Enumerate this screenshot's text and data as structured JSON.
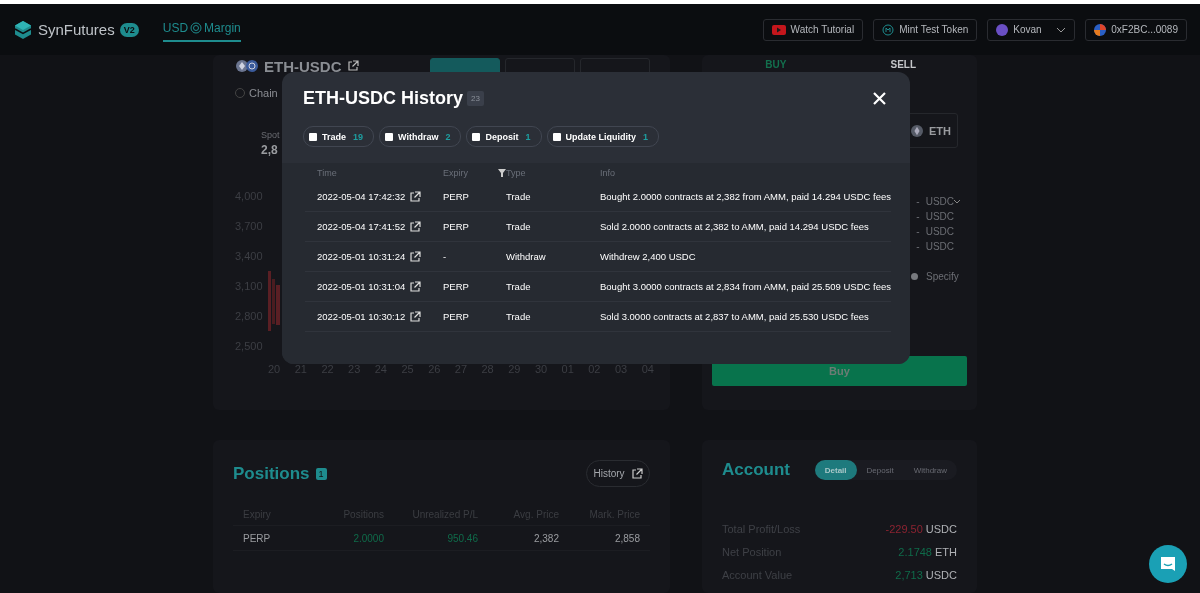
{
  "header": {
    "brand": "SynFutures",
    "version": "V2",
    "nav": [
      {
        "prefix": "USD",
        "suffix": "Margin",
        "selected": true
      }
    ],
    "actions": [
      {
        "kind": "tutorial",
        "label": "Watch Tutorial"
      },
      {
        "kind": "mint",
        "label": "Mint Test Token"
      },
      {
        "kind": "network",
        "label": "Kovan"
      },
      {
        "kind": "wallet",
        "label": "0xF2BC...0089"
      }
    ]
  },
  "trade_panel": {
    "pair": "ETH-USDC",
    "mode_tabs": [
      {
        "selected": true
      },
      {
        "selected": false
      },
      {
        "selected": false
      }
    ],
    "option": {
      "label": "Chain",
      "checked": false
    },
    "spot": {
      "label": "Spot",
      "value": "2,8"
    },
    "chart": {
      "y_labels": [
        "4,000",
        "3,700",
        "3,400",
        "3,100",
        "2,800",
        "2,500"
      ],
      "x_labels": [
        "20",
        "21",
        "22",
        "23",
        "24",
        "25",
        "26",
        "27",
        "28",
        "29",
        "30",
        "01",
        "02",
        "03",
        "04"
      ]
    }
  },
  "order_panel": {
    "sides": [
      {
        "label": "BUY",
        "selected": true
      },
      {
        "label": "SELL",
        "selected": false
      }
    ],
    "asset": "ETH",
    "amounts": [
      {
        "value": "-",
        "unit": "USDC",
        "dropdown": true
      },
      {
        "value": "-",
        "unit": "USDC",
        "dropdown": false
      },
      {
        "value": "-",
        "unit": "USDC",
        "dropdown": false
      },
      {
        "value": "-",
        "unit": "USDC",
        "dropdown": false
      }
    ],
    "option": {
      "label": "Specify",
      "checked": false
    },
    "submit": "Buy"
  },
  "history_modal": {
    "title": "ETH-USDC History",
    "count": "23",
    "filters": [
      {
        "label": "Trade",
        "count": "19",
        "checked": false
      },
      {
        "label": "Withdraw",
        "count": "2",
        "checked": false
      },
      {
        "label": "Deposit",
        "count": "1",
        "checked": false
      },
      {
        "label": "Update Liquidity",
        "count": "1",
        "checked": false
      }
    ],
    "columns": [
      "Time",
      "Expiry",
      "Type",
      "Info"
    ],
    "rows": [
      {
        "time": "2022-05-04 17:42:32",
        "expiry": "PERP",
        "type": "Trade",
        "info": "Bought 2.0000 contracts at 2,382 from AMM, paid 14.294 USDC fees"
      },
      {
        "time": "2022-05-04 17:41:52",
        "expiry": "PERP",
        "type": "Trade",
        "info": "Sold 2.0000 contracts at 2,382 to AMM, paid 14.294 USDC fees"
      },
      {
        "time": "2022-05-01 10:31:24",
        "expiry": "-",
        "type": "Withdraw",
        "info": "Withdrew 2,400 USDC"
      },
      {
        "time": "2022-05-01 10:31:04",
        "expiry": "PERP",
        "type": "Trade",
        "info": "Bought 3.0000 contracts at 2,834 from AMM, paid 25.509 USDC fees"
      },
      {
        "time": "2022-05-01 10:30:12",
        "expiry": "PERP",
        "type": "Trade",
        "info": "Sold 3.0000 contracts at 2,837 to AMM, paid 25.530 USDC fees"
      }
    ]
  },
  "positions": {
    "title": "Positions",
    "count": "1",
    "history_button": "History",
    "columns": [
      "Expiry",
      "Positions",
      "Unrealized P/L",
      "Avg. Price",
      "Mark. Price"
    ],
    "rows": [
      {
        "expiry": "PERP",
        "positions": "2.0000",
        "unrealized": "950.46",
        "avg_price": "2,382",
        "mark_price": "2,858",
        "gain": true
      }
    ]
  },
  "account": {
    "title": "Account",
    "tabs": [
      {
        "label": "Detail",
        "selected": true
      },
      {
        "label": "Deposit",
        "selected": false
      },
      {
        "label": "Withdraw",
        "selected": false
      }
    ],
    "rows": [
      {
        "label": "Total Profit/Loss",
        "value": "-229.50",
        "unit": "USDC",
        "gain": false
      },
      {
        "label": "Net Position",
        "value": "2.1748",
        "unit": "ETH",
        "gain": true
      },
      {
        "label": "Account Value",
        "value": "2,713",
        "unit": "USDC",
        "gain": true
      }
    ]
  }
}
